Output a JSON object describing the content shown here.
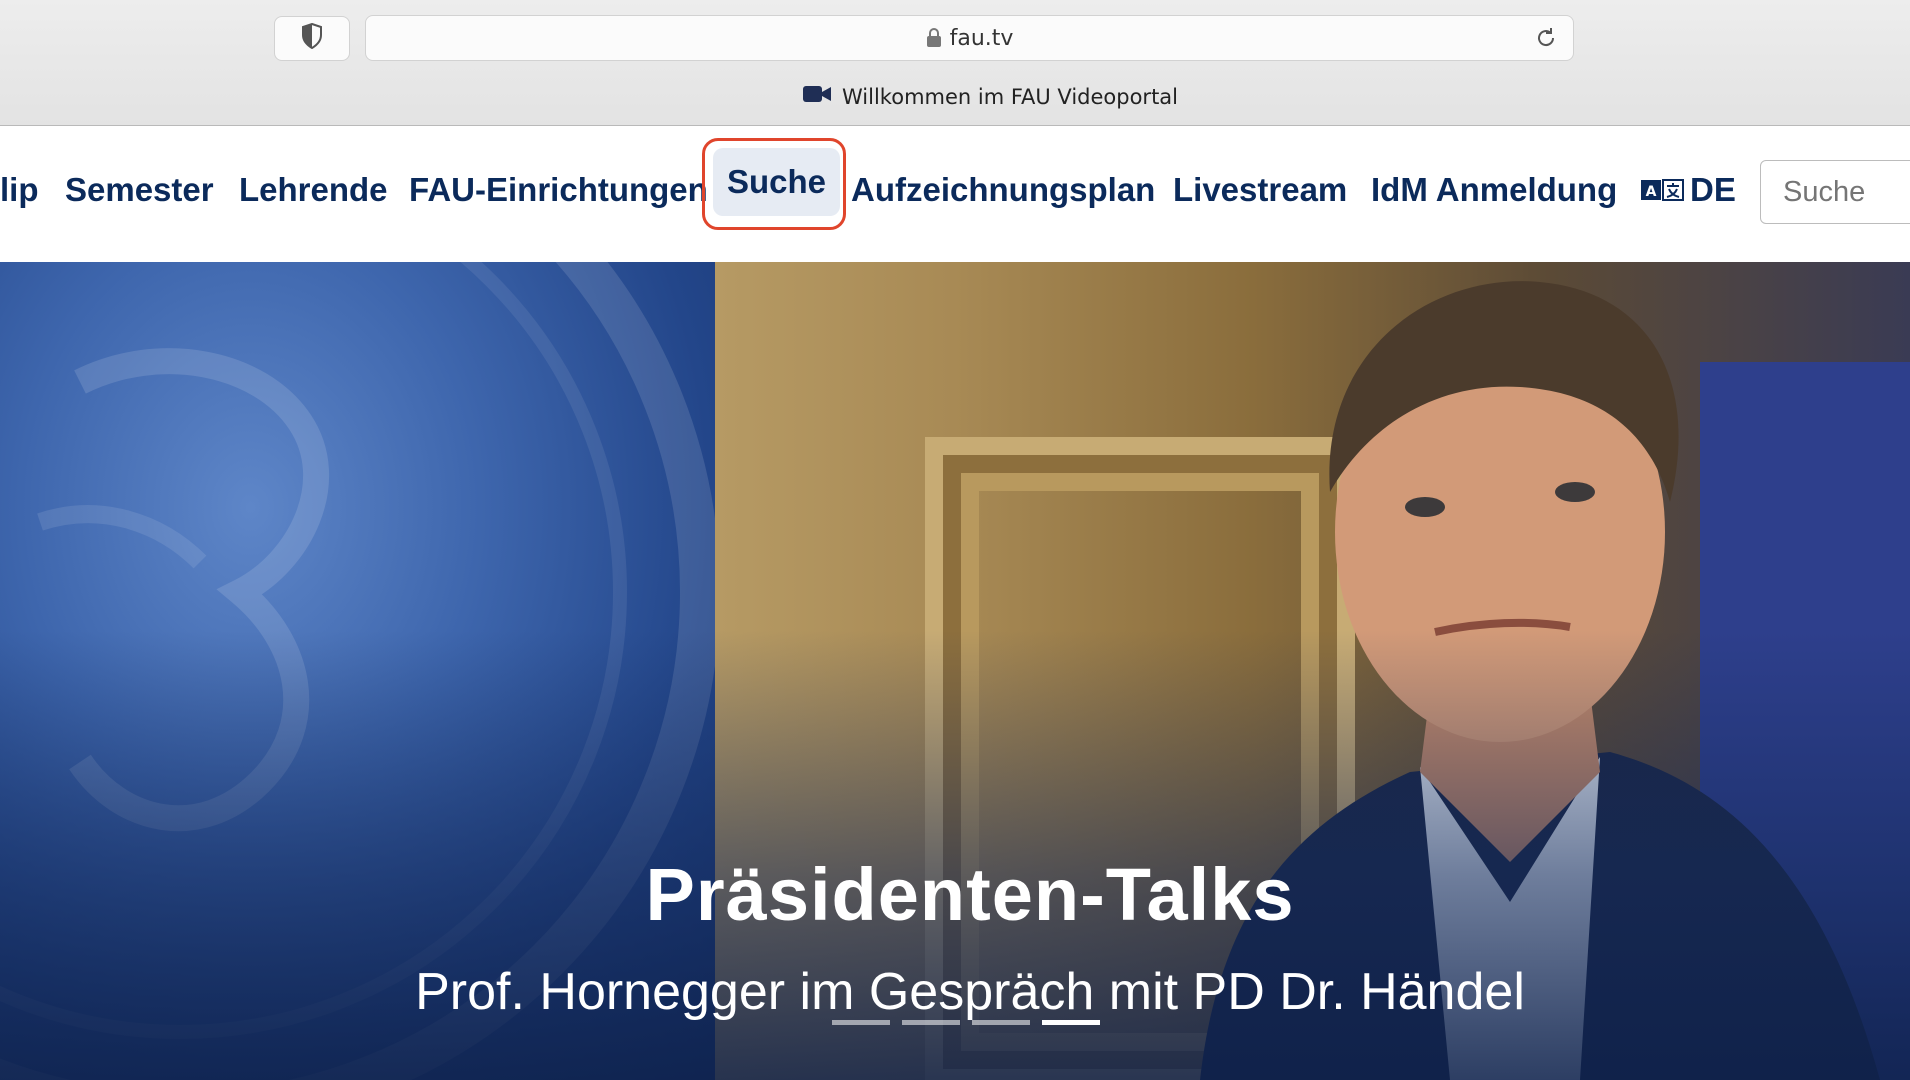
{
  "browser": {
    "url": "fau.tv",
    "tab_title": "Willkommen im FAU Videoportal"
  },
  "nav": {
    "items": [
      {
        "label": "lip"
      },
      {
        "label": "Semester"
      },
      {
        "label": "Lehrende"
      },
      {
        "label": "FAU-Einrichtungen"
      },
      {
        "label": "Suche"
      },
      {
        "label": "Aufzeichnungsplan"
      },
      {
        "label": "Livestream"
      },
      {
        "label": "IdM Anmeldung"
      },
      {
        "label": "DE"
      }
    ],
    "active_item": "Suche",
    "search_placeholder": "Suche"
  },
  "hero": {
    "title": "Präsidenten-Talks",
    "subtitle": "Prof. Hornegger im Gespräch mit PD Dr. Händel",
    "slides_count": 4,
    "active_slide": 4
  },
  "colors": {
    "nav_text": "#0b2a5b",
    "highlight": "#e0452c",
    "hero_blue": "#1d3970"
  }
}
